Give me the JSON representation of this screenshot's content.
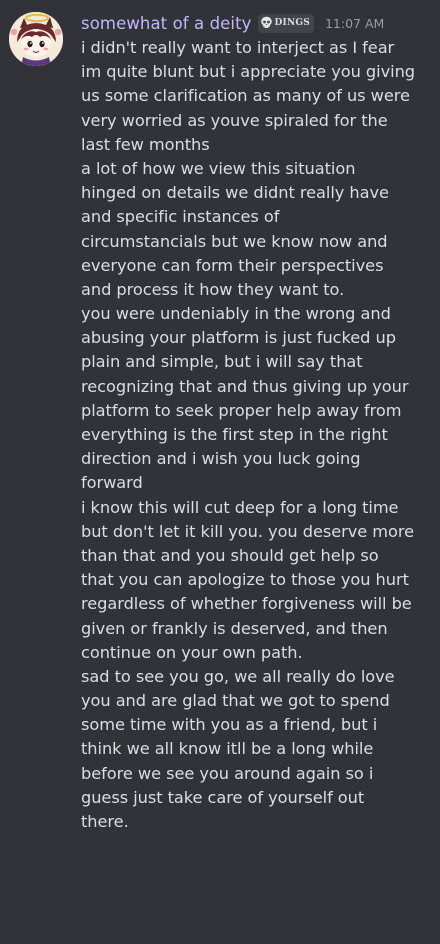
{
  "message": {
    "username": "somewhat of a deity",
    "tag": {
      "icon": "skull-icon",
      "label": "DINGS"
    },
    "timestamp": "11:07 AM",
    "lines": [
      "i didn't really want to interject as I fear",
      "im quite blunt but i appreciate you giving",
      "us some clarification as many of us were",
      "very worried as youve spiraled for the",
      "last few months",
      "a lot of how we view this situation",
      "hinged on details we didnt really have",
      "and specific instances of",
      "circumstancials but we know now and",
      "everyone can form their perspectives",
      "and process it how they want to.",
      "you were undeniably in the wrong and",
      "abusing your platform is just fucked up",
      "plain and simple, but i will say that",
      "recognizing that and thus giving up your",
      "platform to seek proper help away from",
      "everything is the first step in the right",
      "direction and i wish you luck going",
      "forward",
      "i know this will cut deep for a long time",
      "but don't let it kill you. you deserve more",
      "than that and you should get help so",
      "that you can apologize to those you hurt",
      "regardless of whether forgiveness will be",
      "given or frankly is deserved, and then",
      "continue on your own path.",
      "sad to see you go, we all really do love",
      "you and are glad that we got to spend",
      "some time with you as a friend, but i",
      "think we all know itll be a long while",
      "before we see you around again so i",
      "guess just take care of yourself out",
      "there."
    ]
  },
  "colors": {
    "background": "#313338",
    "username": "#c4b5fd",
    "text": "#dbdee1",
    "timestamp": "#949ba4",
    "tag_background": "#43444b"
  }
}
